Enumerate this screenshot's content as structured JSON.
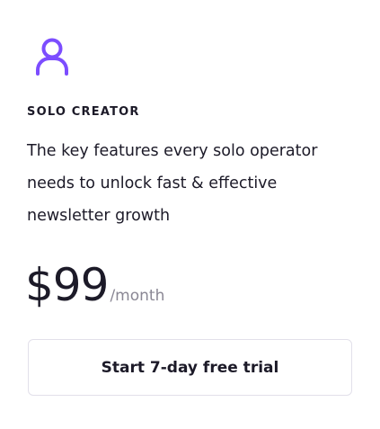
{
  "plan": {
    "icon": "user-icon",
    "icon_color": "#7c4dff",
    "name": "SOLO CREATOR",
    "description": "The key features every solo operator needs to unlock fast & effective newsletter growth",
    "price": "$99",
    "period": "/month"
  },
  "cta": {
    "label": "Start 7-day free trial"
  },
  "colors": {
    "text": "#1c1a28",
    "muted": "#8a8794",
    "border": "#e2e0ea"
  }
}
